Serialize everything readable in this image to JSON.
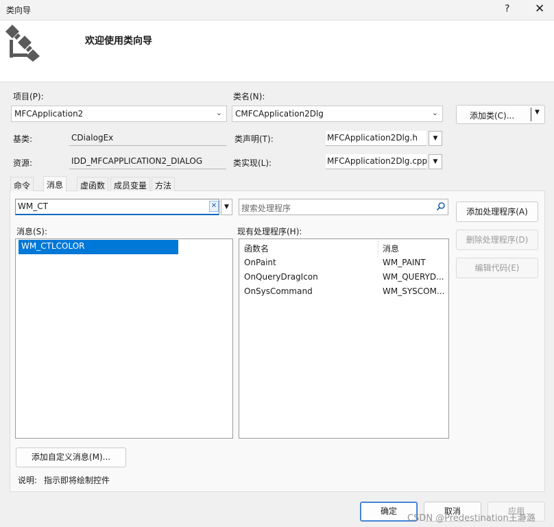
{
  "window": {
    "title": "类向导",
    "help": "?",
    "close": "✕"
  },
  "header": {
    "welcome": "欢迎使用类向导"
  },
  "project": {
    "label": "项目(P):",
    "value": "MFCApplication2"
  },
  "class_name": {
    "label": "类名(N):",
    "value": "CMFCApplication2Dlg"
  },
  "add_class_button": "添加类(C)...",
  "base_class": {
    "label": "基类:",
    "value": "CDialogEx"
  },
  "resource": {
    "label": "资源:",
    "value": "IDD_MFCAPPLICATION2_DIALOG"
  },
  "class_decl": {
    "label": "类声明(T):",
    "value": "MFCApplication2Dlg.h"
  },
  "class_impl": {
    "label": "类实现(L):",
    "value": "MFCApplication2Dlg.cpp"
  },
  "tabs": [
    {
      "label": "命令"
    },
    {
      "label": "消息"
    },
    {
      "label": "虚函数"
    },
    {
      "label": "成员变量"
    },
    {
      "label": "方法"
    }
  ],
  "filter": {
    "value": "WM_CT",
    "clear": "✕"
  },
  "search": {
    "placeholder": "搜索处理程序"
  },
  "messages": {
    "label": "消息(S):",
    "items": [
      "WM_CTLCOLOR"
    ]
  },
  "handlers": {
    "label": "现有处理程序(H):",
    "columns": [
      "函数名",
      "消息"
    ],
    "rows": [
      [
        "OnPaint",
        "WM_PAINT"
      ],
      [
        "OnQueryDragIcon",
        "WM_QUERYD..."
      ],
      [
        "OnSysCommand",
        "WM_SYSCOM..."
      ]
    ]
  },
  "side_buttons": {
    "add_handler": "添加处理程序(A)",
    "delete_handler": "删除处理程序(D)",
    "edit_code": "编辑代码(E)"
  },
  "add_custom_message": "添加自定义消息(M)...",
  "description": {
    "label": "说明:",
    "text": "指示即将绘制控件"
  },
  "footer": {
    "ok": "确定",
    "cancel": "取消",
    "apply": "应用"
  },
  "watermark": "CSDN @Predestination王瀞潞"
}
